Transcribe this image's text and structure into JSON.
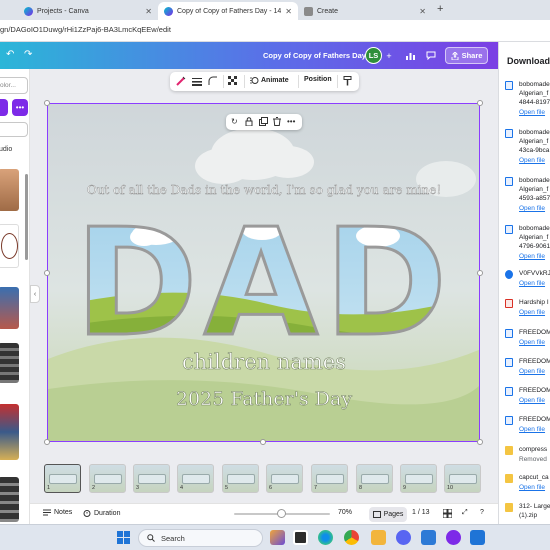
{
  "browser": {
    "tabs": [
      {
        "label": "Projects - Canva",
        "active": false
      },
      {
        "label": "Copy of Copy of Fathers Day - 14",
        "active": true
      },
      {
        "label": "Create",
        "active": false
      }
    ],
    "url": "gn/DAGoIO1Duwg/rHi1ZzPaj6-BA3LmcKqEEw/edit"
  },
  "header": {
    "doc_title": "Copy of Copy of Fathers Day",
    "avatar_initials": "LS",
    "share_label": "Share"
  },
  "left_panel": {
    "color_input_placeholder": "olor...",
    "audio_label": "udio"
  },
  "toolbar": {
    "animate_label": "Animate",
    "position_label": "Position"
  },
  "design": {
    "tagline": "Out of all the Dads in the world, I'm so glad you are mine!",
    "big_word": "DAD",
    "names_line": "children names",
    "year_line": "2025 Father's Day"
  },
  "pages": {
    "thumbnail_numbers": [
      "1",
      "2",
      "3",
      "4",
      "5",
      "6",
      "7",
      "8",
      "9",
      "10"
    ]
  },
  "bottombar": {
    "notes_label": "Notes",
    "duration_label": "Duration",
    "zoom": "70%",
    "pages_label": "Pages",
    "page_indicator": "1 / 13"
  },
  "downloads": {
    "title": "Downloads",
    "items": [
      {
        "name1": "bobomade",
        "name2": "Algerian_f",
        "name3": "4844-8197",
        "action": "Open file"
      },
      {
        "name1": "bobomade",
        "name2": "Algerian_f",
        "name3": "43ca-9bca",
        "action": "Open file"
      },
      {
        "name1": "bobomade",
        "name2": "Algerian_f",
        "name3": "4593-a857",
        "action": "Open file"
      },
      {
        "name1": "bobomade",
        "name2": "Algerian_f",
        "name3": "4796-9061",
        "action": "Open file"
      },
      {
        "name1": "V0FVVkRJ",
        "action": "Open file"
      },
      {
        "name1": "Hardship I",
        "action": "Open file"
      },
      {
        "name1": "FREEDOM",
        "action": "Open file"
      },
      {
        "name1": "FREEDOM",
        "action": "Open file"
      },
      {
        "name1": "FREEDOM",
        "action": "Open file"
      },
      {
        "name1": "FREEDOM",
        "action": "Open file"
      },
      {
        "name1": "compress",
        "status": "Removed"
      },
      {
        "name1": "capcut_ca",
        "action": "Open file"
      },
      {
        "name1": "312- Large",
        "name2": "(1).zip"
      }
    ]
  },
  "taskbar": {
    "search_label": "Search"
  },
  "colors": {
    "brand_purple": "#7d2ae8",
    "selection": "#8b3dff",
    "header_start": "#2bb6d8",
    "header_end": "#7b3fe4"
  }
}
